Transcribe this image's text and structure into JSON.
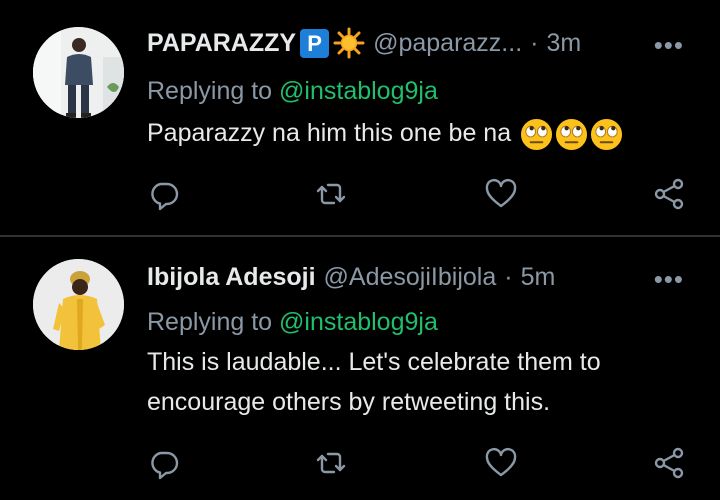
{
  "tweets": [
    {
      "name": "PAPARAZZY",
      "name_badge": "P",
      "handle": "@paparazz...",
      "separator": "·",
      "time": "3m",
      "more": "•••",
      "replying_prefix": "Replying to ",
      "replying_to": "@instablog9ja",
      "text_lines": [
        "Paparazzy na him this one be na"
      ],
      "emojis": [
        "eye-roll-emoji",
        "eye-roll-emoji",
        "eye-roll-emoji"
      ]
    },
    {
      "name": "Ibijola Adesoji",
      "handle": "@AdesojiIbijola",
      "separator": "·",
      "time": "5m",
      "more": "•••",
      "replying_prefix": "Replying to ",
      "replying_to": "@instablog9ja",
      "text_lines": [
        "This is laudable... Let's celebrate them to",
        "encourage others by retweeting this."
      ]
    }
  ],
  "icons": [
    "reply-icon",
    "retweet-icon",
    "like-icon",
    "share-icon"
  ],
  "colors": {
    "background": "#000000",
    "text": "#e7e9ea",
    "muted": "#8b98a5",
    "mention": "#1fbf6b",
    "divider": "#2f3336",
    "badge": "#1d7fd8"
  }
}
